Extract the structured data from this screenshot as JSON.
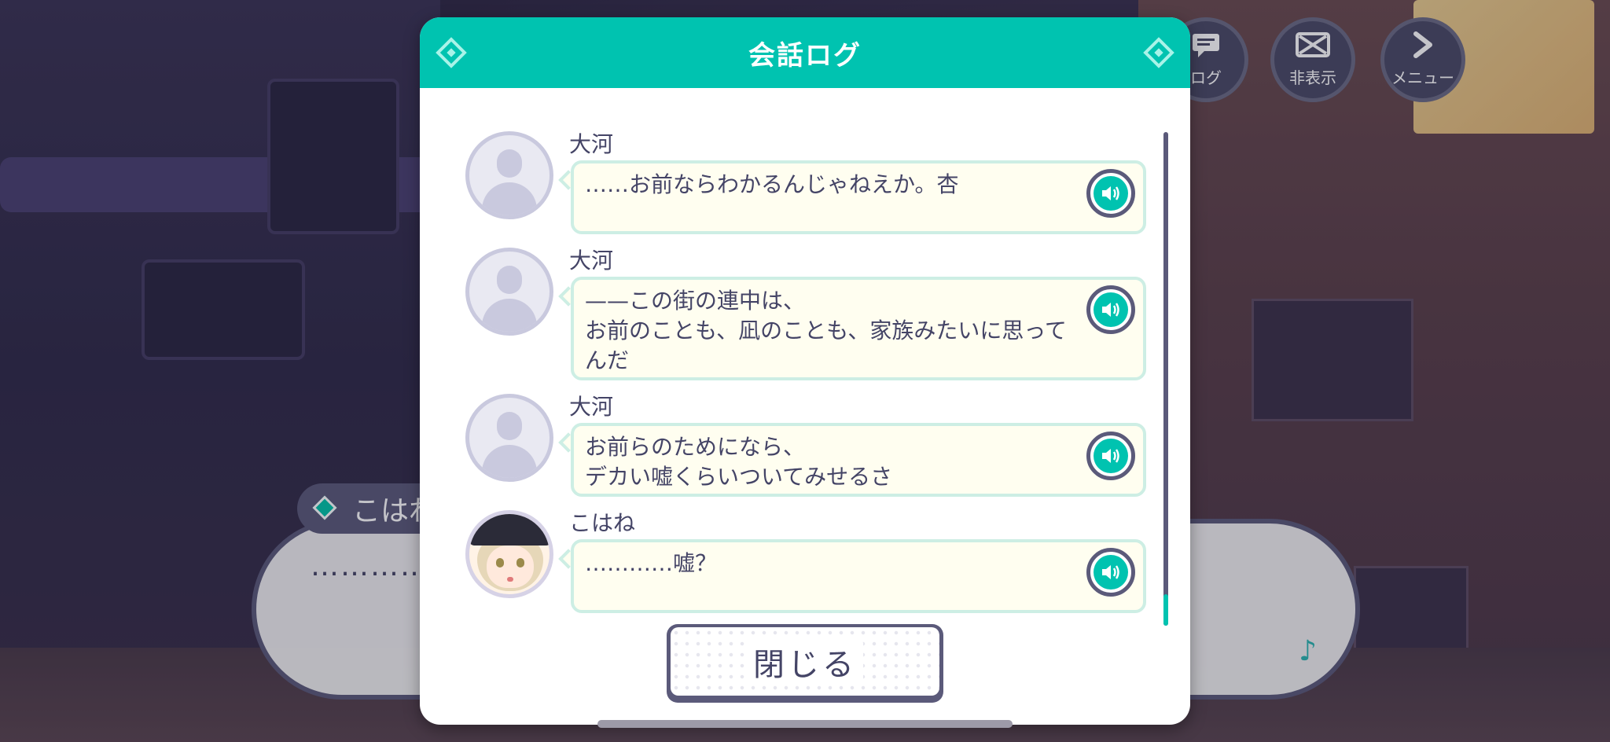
{
  "top_buttons": [
    {
      "label": "ログ",
      "icon": "log-icon"
    },
    {
      "label": "非表示",
      "icon": "hide-icon"
    },
    {
      "label": "メニュー",
      "icon": "menu-chevron-icon"
    }
  ],
  "story": {
    "speaker": "こはね",
    "text": "…………"
  },
  "modal": {
    "title": "会話ログ",
    "close_label": "閉じる"
  },
  "log": [
    {
      "speaker": "大河",
      "text": "……お前ならわかるんじゃねえか。杏",
      "avatar": "placeholder"
    },
    {
      "speaker": "大河",
      "text": "——この街の連中は、\nお前のことも、凪のことも、家族みたいに思ってんだ",
      "avatar": "placeholder"
    },
    {
      "speaker": "大河",
      "text": "お前らのためになら、\nデカい嘘くらいついてみせるさ",
      "avatar": "placeholder"
    },
    {
      "speaker": "こはね",
      "text": "…………嘘？",
      "avatar": "kohane"
    }
  ],
  "colors": {
    "accent": "#00c3b0",
    "frame": "#5b5a7a",
    "text": "#444466",
    "bubble_bg": "#fffef0"
  }
}
